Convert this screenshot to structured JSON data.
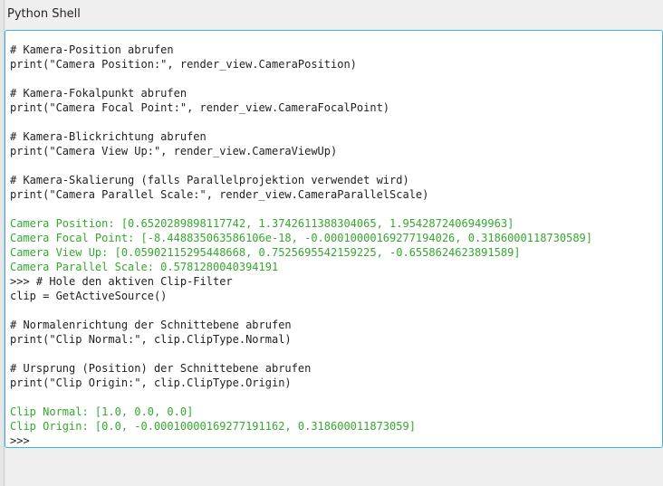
{
  "window": {
    "title": "Python Shell"
  },
  "console": {
    "lines": [
      {
        "text": "# Kamera-Position abrufen",
        "kind": "code"
      },
      {
        "text": "print(\"Camera Position:\", render_view.CameraPosition)",
        "kind": "code"
      },
      {
        "text": "",
        "kind": "code"
      },
      {
        "text": "# Kamera-Fokalpunkt abrufen",
        "kind": "code"
      },
      {
        "text": "print(\"Camera Focal Point:\", render_view.CameraFocalPoint)",
        "kind": "code"
      },
      {
        "text": "",
        "kind": "code"
      },
      {
        "text": "# Kamera-Blickrichtung abrufen",
        "kind": "code"
      },
      {
        "text": "print(\"Camera View Up:\", render_view.CameraViewUp)",
        "kind": "code"
      },
      {
        "text": "",
        "kind": "code"
      },
      {
        "text": "# Kamera-Skalierung (falls Parallelprojektion verwendet wird)",
        "kind": "code"
      },
      {
        "text": "print(\"Camera Parallel Scale:\", render_view.CameraParallelScale)",
        "kind": "code"
      },
      {
        "text": "",
        "kind": "code"
      },
      {
        "text": "Camera Position: [0.6520289898117742, 1.3742611388304065, 1.9542872406949963]",
        "kind": "out"
      },
      {
        "text": "Camera Focal Point: [-8.448835063586106e-18, -0.00010000169277194026, 0.3186000118730589]",
        "kind": "out"
      },
      {
        "text": "Camera View Up: [0.05902115295448668, 0.7525695542159225, -0.6558624623891589]",
        "kind": "out"
      },
      {
        "text": "Camera Parallel Scale: 0.5781280040394191",
        "kind": "out"
      },
      {
        "text": ">>> # Hole den aktiven Clip-Filter",
        "kind": "code"
      },
      {
        "text": "clip = GetActiveSource()",
        "kind": "code"
      },
      {
        "text": "",
        "kind": "code"
      },
      {
        "text": "# Normalenrichtung der Schnittebene abrufen",
        "kind": "code"
      },
      {
        "text": "print(\"Clip Normal:\", clip.ClipType.Normal)",
        "kind": "code"
      },
      {
        "text": "",
        "kind": "code"
      },
      {
        "text": "# Ursprung (Position) der Schnittebene abrufen",
        "kind": "code"
      },
      {
        "text": "print(\"Clip Origin:\", clip.ClipType.Origin)",
        "kind": "code"
      },
      {
        "text": "",
        "kind": "code"
      },
      {
        "text": "Clip Normal: [1.0, 0.0, 0.0]",
        "kind": "out"
      },
      {
        "text": "Clip Origin: [0.0, -0.00010000169277191162, 0.318600011873059]",
        "kind": "out"
      },
      {
        "text": ">>>",
        "kind": "code"
      }
    ]
  },
  "colors": {
    "code_text": "#1f1f1f",
    "output_text": "#34a82e",
    "focus_border": "#3daee9"
  }
}
